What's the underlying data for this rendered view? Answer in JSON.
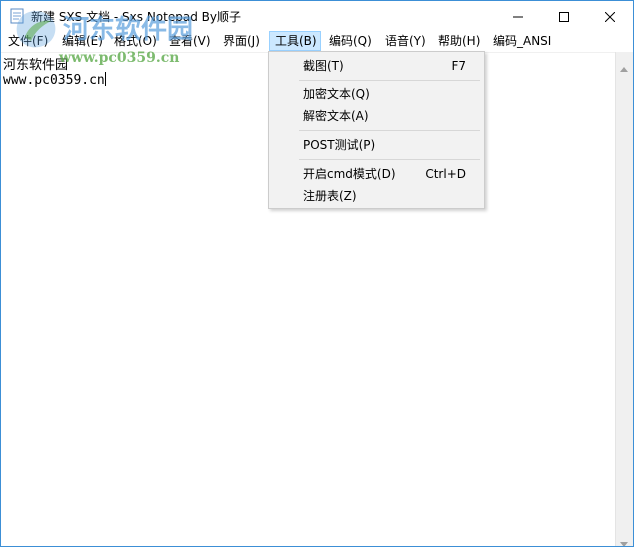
{
  "window": {
    "title": "新建 SXS 文档 - Sxs Notepad  By顺子",
    "accent_color": "#3c8fd6"
  },
  "watermark": {
    "text": "河东软件园",
    "url": "www.pc0359.cn"
  },
  "menubar": {
    "items": [
      {
        "label": "文件(F)"
      },
      {
        "label": "编辑(E)"
      },
      {
        "label": "格式(O)"
      },
      {
        "label": "查看(V)"
      },
      {
        "label": "界面(J)"
      },
      {
        "label": "工具(B)"
      },
      {
        "label": "编码(Q)"
      },
      {
        "label": "语音(Y)"
      },
      {
        "label": "帮助(H)"
      },
      {
        "label": "编码_ANSI"
      }
    ],
    "active_item": "工具(B)"
  },
  "tools_menu": {
    "items": [
      {
        "label": "截图(T)",
        "shortcut": "F7"
      },
      {
        "label": "加密文本(Q)",
        "shortcut": ""
      },
      {
        "label": "解密文本(A)",
        "shortcut": ""
      },
      {
        "label": "POST测试(P)",
        "shortcut": ""
      },
      {
        "label": "开启cmd模式(D)",
        "shortcut": "Ctrl+D"
      },
      {
        "label": "注册表(Z)",
        "shortcut": ""
      }
    ]
  },
  "editor": {
    "lines": [
      "河东软件园",
      "www.pc0359.cn"
    ]
  },
  "icons": {
    "app": "notepad-app-icon",
    "minimize": "minimize-icon",
    "maximize": "maximize-icon",
    "close": "close-icon",
    "scroll_up": "scroll-up-arrow-icon",
    "scroll_down": "scroll-down-arrow-icon"
  }
}
